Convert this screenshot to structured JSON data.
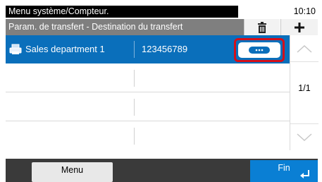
{
  "status": {
    "title": "Menu système/Compteur.",
    "time": "10:10"
  },
  "toolbar": {
    "breadcrumb": "Param. de transfert  - Destination du transfert",
    "delete_icon": "trash-icon",
    "add_icon": "plus-icon"
  },
  "list": {
    "rows": [
      {
        "name": "Sales department 1",
        "number": "123456789",
        "icon": "printer-icon",
        "selected": true,
        "detail_icon": "more-ellipsis-icon"
      },
      {
        "name": "",
        "number": ""
      },
      {
        "name": "",
        "number": ""
      },
      {
        "name": "",
        "number": ""
      }
    ]
  },
  "scroll": {
    "page": "1/1",
    "up_icon": "chevron-up-icon",
    "down_icon": "chevron-down-icon"
  },
  "bottom": {
    "menu_label": "Menu",
    "fin_label": "Fin",
    "enter_icon": "enter-arrow-icon"
  },
  "colors": {
    "selected_row": "#0a6fbb",
    "highlight": "#d40f1a",
    "fin_button": "#0a7fd4"
  }
}
